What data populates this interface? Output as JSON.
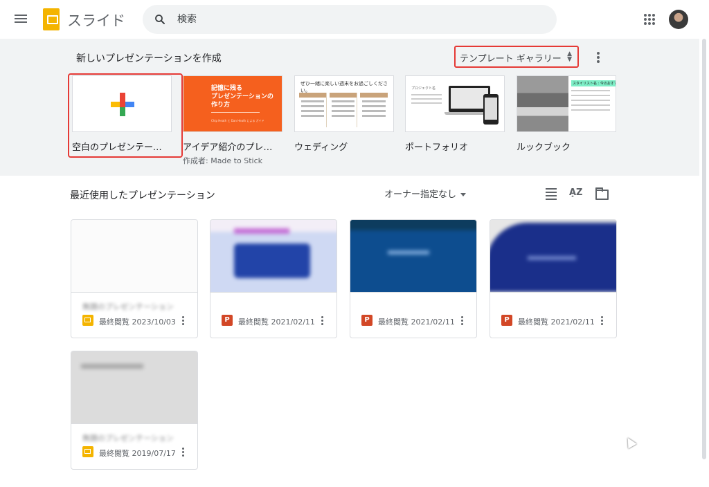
{
  "app": {
    "title": "スライド"
  },
  "search": {
    "placeholder": "検索"
  },
  "templates": {
    "heading": "新しいプレゼンテーションを作成",
    "gallery_label": "テンプレート ギャラリー",
    "items": [
      {
        "name": "空白のプレゼンテーシ…",
        "sub": ""
      },
      {
        "name": "アイデア紹介のプレゼ…",
        "sub": "作成者: Made to Stick",
        "thumb_title": "記憶に残る\nプレゼンテーションの\n作り方",
        "thumb_sub": "Chip Heath と Dan Heath による ガイド"
      },
      {
        "name": "ウェディング",
        "sub": "",
        "thumb_title": "ぜひ一緒に楽しい週末をお過ごしください。"
      },
      {
        "name": "ポートフォリオ",
        "sub": "",
        "thumb_title": "プロジェクト名"
      },
      {
        "name": "ルックブック",
        "sub": "",
        "thumb_title": "スタイリスト名 : 今のおすすめ"
      }
    ]
  },
  "recent": {
    "heading": "最近使用したプレゼンテーション",
    "owner_filter": "オーナー指定なし",
    "sort_label": "A͎Z",
    "cards": [
      {
        "name": "無題のプレゼンテーション",
        "type": "slides",
        "date": "最終閲覧 2023/10/03"
      },
      {
        "name": "",
        "type": "ppt",
        "type_label": "P",
        "date": "最終閲覧 2021/02/11"
      },
      {
        "name": "",
        "type": "ppt",
        "type_label": "P",
        "date": "最終閲覧 2021/02/11"
      },
      {
        "name": "",
        "type": "ppt",
        "type_label": "P",
        "date": "最終閲覧 2021/02/11"
      },
      {
        "name": "無題のプレゼンテーション",
        "type": "slides",
        "date": "最終閲覧 2019/07/17"
      }
    ]
  },
  "colors": {
    "accent": "#f4b400",
    "highlight": "#e53935",
    "ppt": "#d24726"
  }
}
